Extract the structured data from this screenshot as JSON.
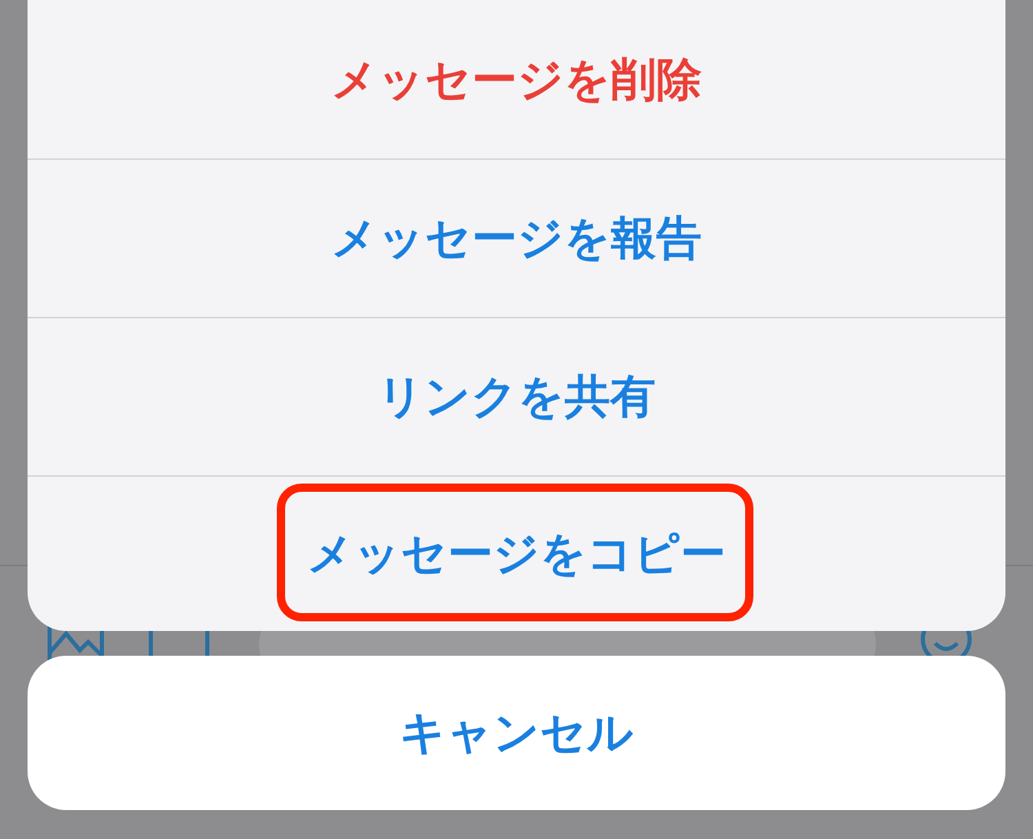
{
  "action_sheet": {
    "actions": [
      {
        "label": "メッセージを削除",
        "kind": "destructive",
        "highlighted": false
      },
      {
        "label": "メッセージを報告",
        "kind": "default",
        "highlighted": false
      },
      {
        "label": "リンクを共有",
        "kind": "default",
        "highlighted": false
      },
      {
        "label": "メッセージをコピー",
        "kind": "default",
        "highlighted": true
      }
    ],
    "cancel": "キャンセル"
  }
}
